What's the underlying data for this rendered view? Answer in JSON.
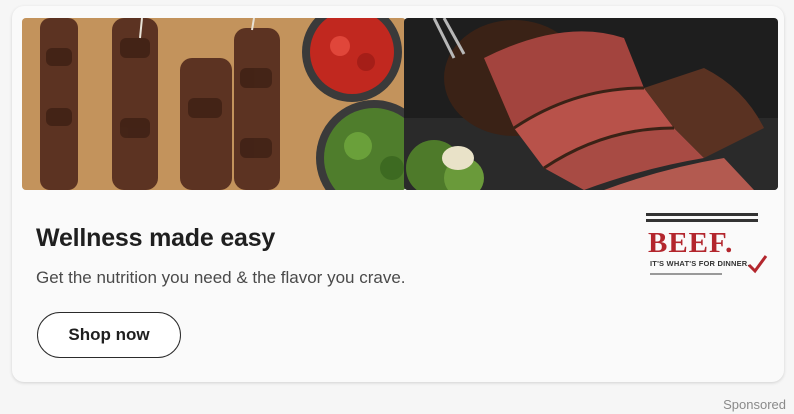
{
  "ad": {
    "headline": "Wellness made easy",
    "subtext": "Get the nutrition you need & the flavor you crave.",
    "cta_label": "Shop now",
    "sponsored_label": "Sponsored"
  },
  "brand": {
    "word": "BEEF.",
    "tagline": "IT'S WHAT'S FOR DINNER.",
    "color": "#b3262d"
  },
  "images": {
    "left": "beef-kebab-skewers-photo",
    "right": "sliced-roast-beef-photo"
  }
}
